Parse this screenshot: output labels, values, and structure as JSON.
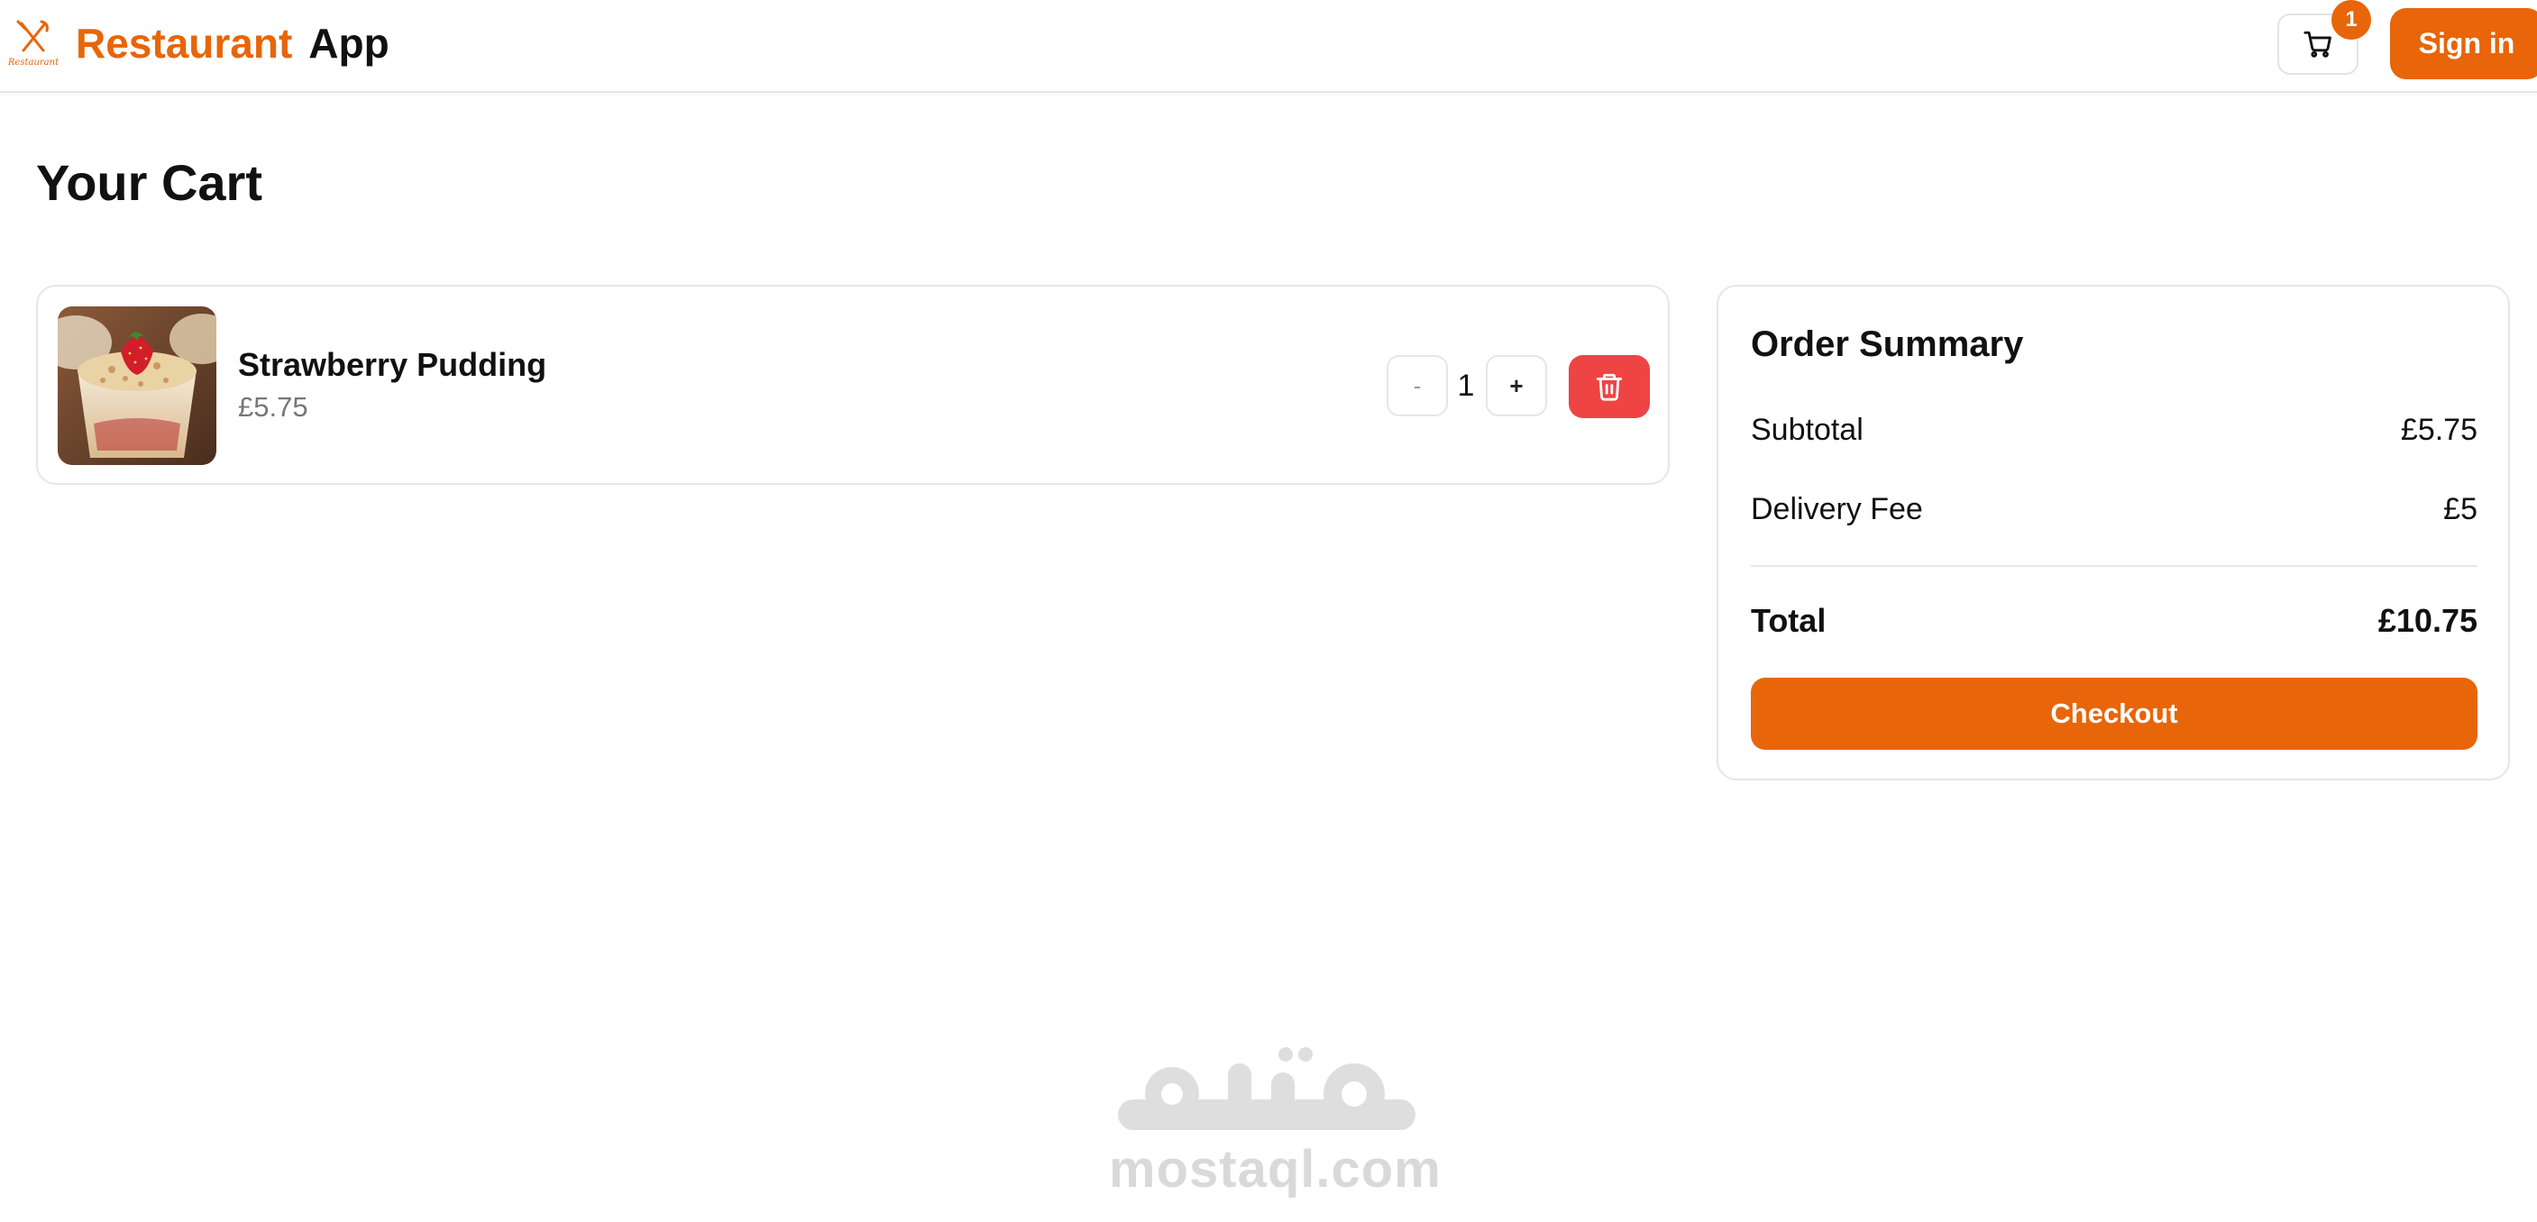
{
  "app": {
    "brand_accent": "Restaurant",
    "brand_rest": "App",
    "logo_word": "Restaurant",
    "accent_color": "#e8650a"
  },
  "header": {
    "cart_count": "1",
    "signin_label": "Sign in",
    "icons": [
      "utensils-icon",
      "cart-icon"
    ]
  },
  "page": {
    "title": "Your Cart"
  },
  "cart": {
    "items": [
      {
        "name": "Strawberry Pudding",
        "price": "£5.75",
        "quantity": "1",
        "minus_label": "-",
        "plus_label": "+",
        "image": "strawberry-pudding-photo"
      }
    ],
    "delete_color": "#ee4444"
  },
  "summary": {
    "title": "Order Summary",
    "subtotal_label": "Subtotal",
    "subtotal_value": "£5.75",
    "delivery_label": "Delivery Fee",
    "delivery_value": "£5",
    "total_label": "Total",
    "total_value": "£10.75",
    "checkout_label": "Checkout"
  },
  "watermark": {
    "text": "mostaql.com"
  }
}
